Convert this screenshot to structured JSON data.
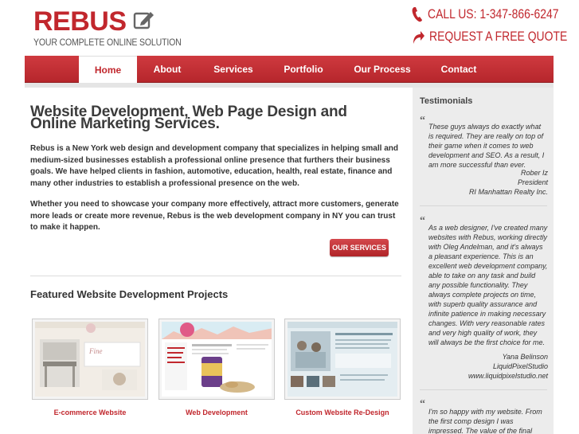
{
  "brand": {
    "name": "REBUS",
    "tagline": "YOUR COMPLETE ONLINE SOLUTION",
    "color": "#c1272d"
  },
  "contact": {
    "call": "CALL US: 1-347-866-6247",
    "quote": "REQUEST A FREE QUOTE"
  },
  "nav": {
    "items": [
      "Home",
      "About",
      "Services",
      "Portfolio",
      "Our Process",
      "Contact"
    ],
    "active": "Home"
  },
  "main": {
    "headline": "Website Development, Web Page Design and Online Marketing Services.",
    "paragraph1": "Rebus is a New York web design and development company that specializes in helping small and medium-sized businesses establish a professional online presence that furthers their business goals. We have helped clients in fashion, automotive, education, health, real estate, finance and many other industries to establish a professional presence on the web.",
    "paragraph2": "Whether you need to showcase your company more effectively, attract more customers, generate more leads or create more revenue, Rebus is the web development company in NY you can trust to make it happen.",
    "services_button": "OUR SERVICES",
    "featured_title": "Featured Website Development Projects",
    "projects": [
      {
        "caption": "E-commerce Website"
      },
      {
        "caption": "Web Development"
      },
      {
        "caption": "Custom Website Re-Design"
      }
    ]
  },
  "sidebar": {
    "title": "Testimonials",
    "testimonials": [
      {
        "text": "These guys always do exactly what is required. They are really on top of their game when it comes to web development and SEO. As a result, I am more successful than ever.",
        "author_lines": [
          "Rober Iz",
          "President",
          "RI Manhattan Realty Inc."
        ]
      },
      {
        "text": "As a web designer, I've created many websites with Rebus, working directly with Oleg Andelman, and it's always a pleasant experience. This is an excellent web development company, able to take on any task and build any possible functionality. They always complete projects on time, with superb quality assurance and infinite patience in making necessary changes.  With very reasonable rates and very high quality of work, they will always be the first choice for me.",
        "author_lines": [
          "Yana Belinson",
          "LiquidPixelStudio",
          "www.liquidpixelstudio.net"
        ]
      },
      {
        "text": "I'm so happy with my website. From the first comp design I was impressed.  The value of the final",
        "author_lines": []
      }
    ]
  }
}
